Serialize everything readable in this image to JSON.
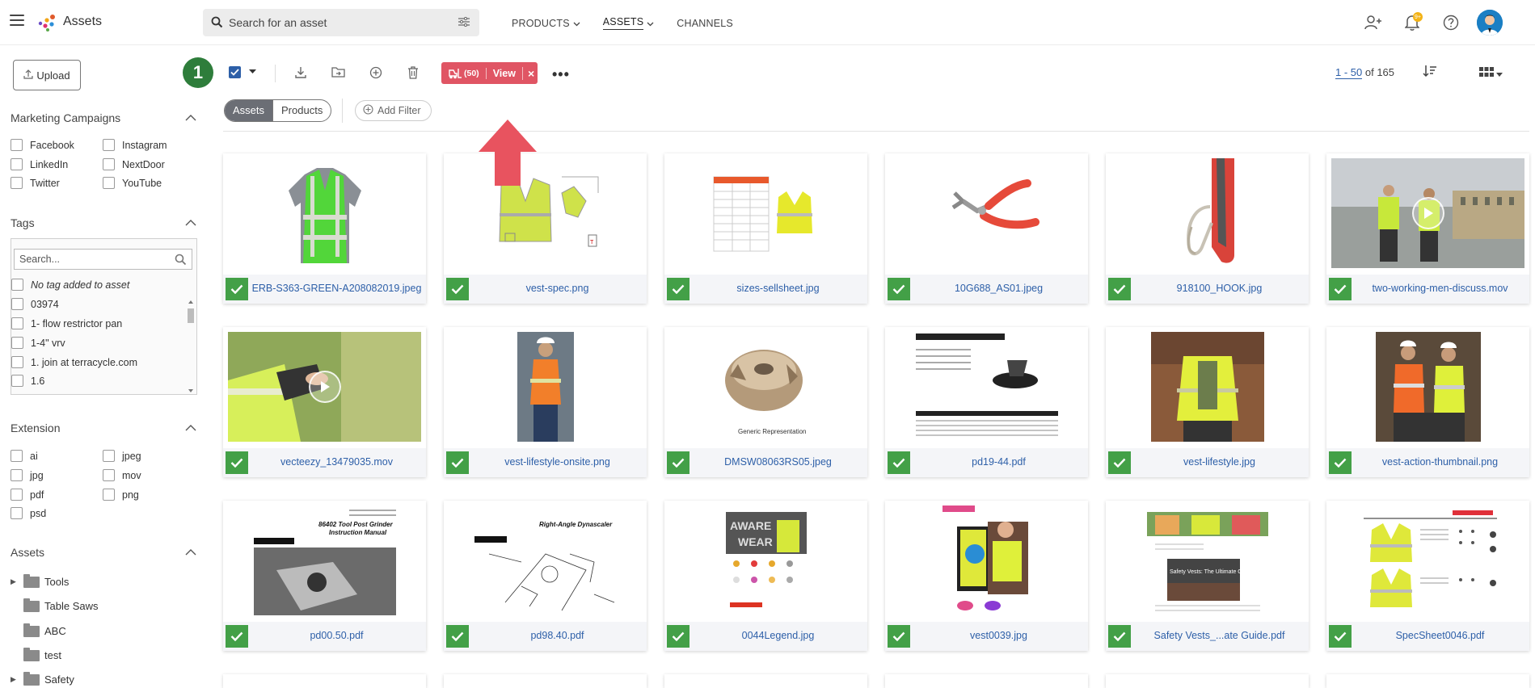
{
  "app": {
    "title": "Assets"
  },
  "search": {
    "placeholder": "Search for an asset"
  },
  "nav": [
    {
      "label": "PRODUCTS",
      "has_dropdown": true,
      "active": false
    },
    {
      "label": "ASSETS",
      "has_dropdown": true,
      "active": true
    },
    {
      "label": "CHANNELS",
      "has_dropdown": false,
      "active": false
    }
  ],
  "notifications": {
    "badge": "9+"
  },
  "sidebar": {
    "upload_label": "Upload",
    "marketing": {
      "title": "Marketing Campaigns",
      "items": [
        "Facebook",
        "Instagram",
        "LinkedIn",
        "NextDoor",
        "Twitter",
        "YouTube"
      ]
    },
    "tags": {
      "title": "Tags",
      "search_placeholder": "Search...",
      "items": [
        "No tag added to asset",
        "03974",
        "1- flow restrictor pan",
        "1-4\" vrv",
        "1. join at terracycle.com",
        "1.6"
      ]
    },
    "extension": {
      "title": "Extension",
      "items": [
        "ai",
        "jpeg",
        "jpg",
        "mov",
        "pdf",
        "png",
        "psd"
      ]
    },
    "assets": {
      "title": "Assets",
      "folders": [
        {
          "label": "Tools",
          "expandable": true
        },
        {
          "label": "Table Saws",
          "expandable": false
        },
        {
          "label": "ABC",
          "expandable": false
        },
        {
          "label": "test",
          "expandable": false
        },
        {
          "label": "Safety",
          "expandable": true
        }
      ]
    }
  },
  "toolbar": {
    "step": "1",
    "selection_count": "(50)",
    "view_label": "View",
    "close": "×",
    "more": "•••",
    "pager": {
      "range": "1 - 50",
      "total": " of 165"
    }
  },
  "filters": {
    "segments": [
      "Assets",
      "Products"
    ],
    "active_segment": "Assets",
    "add_filter": "Add Filter"
  },
  "assets": [
    {
      "name": "ERB-S363-GREEN-A208082019.jpeg",
      "kind": "vest-green"
    },
    {
      "name": "vest-spec.png",
      "kind": "vest-spec"
    },
    {
      "name": "sizes-sellsheet.jpg",
      "kind": "sellsheet"
    },
    {
      "name": "10G688_AS01.jpeg",
      "kind": "pliers"
    },
    {
      "name": "918100_HOOK.jpg",
      "kind": "hook"
    },
    {
      "name": "two-working-men-discuss.mov",
      "kind": "video-men"
    },
    {
      "name": "vecteezy_13479035.mov",
      "kind": "video-tablet"
    },
    {
      "name": "vest-lifestyle-onsite.png",
      "kind": "person-orange"
    },
    {
      "name": "DMSW08063RS05.jpeg",
      "kind": "cutter"
    },
    {
      "name": "pd19-44.pdf",
      "kind": "doc-sander"
    },
    {
      "name": "vest-lifestyle.jpg",
      "kind": "person-yellow"
    },
    {
      "name": "vest-action-thumbnail.png",
      "kind": "two-workers"
    },
    {
      "name": "pd00.50.pdf",
      "kind": "doc-grinder"
    },
    {
      "name": "pd98.40.pdf",
      "kind": "doc-drawing"
    },
    {
      "name": "0044Legend.jpg",
      "kind": "legend"
    },
    {
      "name": "vest0039.jpg",
      "kind": "vest-poster"
    },
    {
      "name": "Safety Vests_...ate Guide.pdf",
      "kind": "guide"
    },
    {
      "name": "SpecSheet0046.pdf",
      "kind": "specsheet"
    }
  ],
  "colors": {
    "brand_blue": "#2d5fa8",
    "check_green": "#43a047",
    "step_green": "#2e7d3b",
    "alert_red": "#e05564"
  }
}
